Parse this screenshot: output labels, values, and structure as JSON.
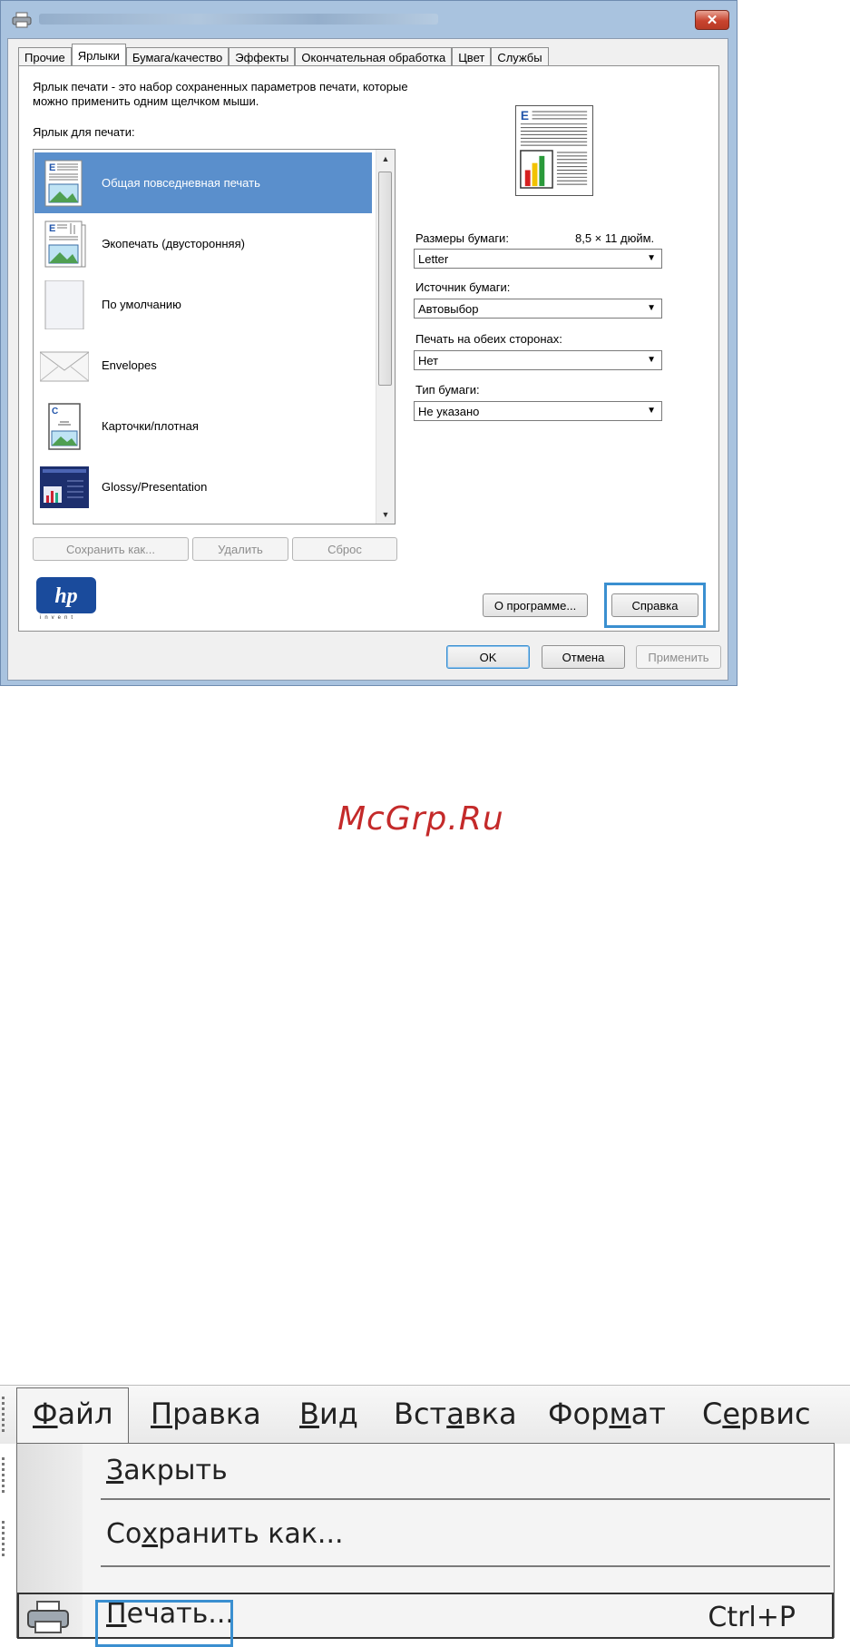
{
  "dialog": {
    "tabs": [
      "Прочие",
      "Ярлыки",
      "Бумага/качество",
      "Эффекты",
      "Окончательная обработка",
      "Цвет",
      "Службы"
    ],
    "active_tab": "Ярлыки",
    "description_line1": "Ярлык печати - это набор сохраненных параметров печати, которые",
    "description_line2": "можно применить одним щелчком мыши.",
    "shortcut_label": "Ярлык для печати:",
    "shortcuts": [
      {
        "label": "Общая повседневная печать",
        "icon": "document-with-image-icon",
        "selected": true
      },
      {
        "label": "Экопечать (двусторонняя)",
        "icon": "duplex-document-icon",
        "selected": false
      },
      {
        "label": "По умолчанию",
        "icon": "blank-page-icon",
        "selected": false
      },
      {
        "label": "Envelopes",
        "icon": "envelope-icon",
        "selected": false
      },
      {
        "label": "Карточки/плотная",
        "icon": "card-stock-icon",
        "selected": false
      },
      {
        "label": "Glossy/Presentation",
        "icon": "presentation-icon",
        "selected": false
      }
    ],
    "list_buttons": {
      "save_as": "Сохранить как...",
      "delete": "Удалить",
      "reset": "Сброс"
    },
    "paper_size_label": "Размеры бумаги:",
    "paper_size_value": "8,5 × 11 дюйм.",
    "paper_size_select": "Letter",
    "paper_source_label": "Источник бумаги:",
    "paper_source_select": "Автовыбор",
    "duplex_label": "Печать на обеих сторонах:",
    "duplex_select": "Нет",
    "paper_type_label": "Тип бумаги:",
    "paper_type_select": "Не указано",
    "about_button": "О программе...",
    "help_button": "Справка",
    "ok_button": "OK",
    "cancel_button": "Отмена",
    "apply_button": "Применить",
    "logo_text": "hp",
    "logo_tagline": "invent"
  },
  "watermark": "McGrp.Ru",
  "menu": {
    "menubar": [
      {
        "accel": "Ф",
        "rest": "айл"
      },
      {
        "accel": "П",
        "rest": "равка"
      },
      {
        "accel": "В",
        "rest": "ид"
      },
      {
        "pre": "Вст",
        "accel": "а",
        "rest": "вка"
      },
      {
        "pre": "Фор",
        "accel": "м",
        "rest": "ат"
      },
      {
        "pre": "С",
        "accel": "е",
        "rest": "рвис"
      }
    ],
    "items": {
      "close": {
        "accel": "З",
        "rest": "акрыть"
      },
      "save_as": {
        "pre": "Со",
        "accel": "х",
        "rest": "ранить как..."
      },
      "print": {
        "accel": "П",
        "rest": "ечать..."
      },
      "print_shortcut": "Ctrl+P"
    }
  },
  "colors": {
    "selection": "#5a8fcc",
    "highlight_frame": "#3a8fd0",
    "watermark": "#c42a2a"
  }
}
